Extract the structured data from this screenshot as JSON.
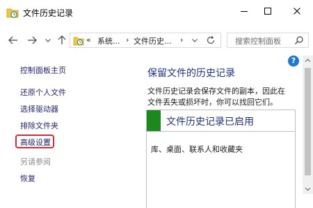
{
  "window": {
    "title": "文件历史记录"
  },
  "navigation": {
    "address": {
      "prefix": "«",
      "crumbs": [
        "系统...",
        "文件历史..."
      ]
    },
    "search": {
      "placeholder": "搜索控制面板"
    }
  },
  "sidebar": {
    "home_link": "控制面板主页",
    "links": [
      "还原个人文件",
      "选择驱动器",
      "排除文件夹",
      "高级设置"
    ],
    "highlighted_link": "高级设置",
    "see_also_heading": "另请参阅",
    "see_also_links": [
      "恢复"
    ]
  },
  "main": {
    "title": "保留文件的历史记录",
    "description_lines": [
      "文件历史记录会保存文件的副本，因此在",
      "文件丢失或损坏时，你可以找回它们。"
    ],
    "status": {
      "header": "文件历史记录已启用",
      "content": "库、桌面、联系人和收藏夹"
    }
  },
  "colors": {
    "status_accent": "#1b8a1b",
    "title_blue": "#1e3287",
    "highlight_red": "#d8293a",
    "help_blue": "#1c7ad3"
  },
  "icons": {
    "app": "file-history-icon",
    "back": "back-arrow-icon",
    "forward": "forward-arrow-icon",
    "up": "up-arrow-icon",
    "refresh": "refresh-icon",
    "search": "search-icon",
    "help": "help-icon"
  }
}
